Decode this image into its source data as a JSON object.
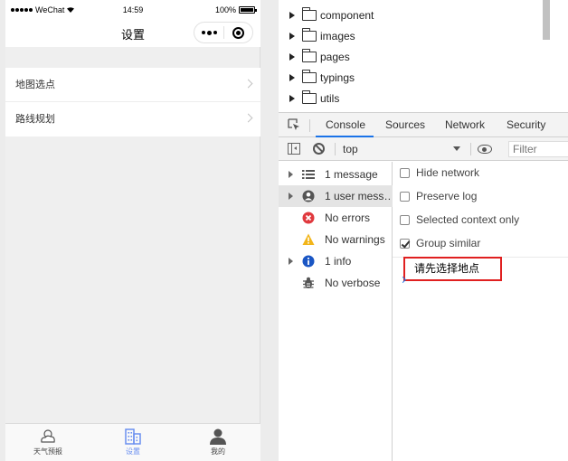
{
  "status_bar": {
    "carrier": "WeChat",
    "time": "14:59",
    "battery": "100%"
  },
  "navbar": {
    "title": "设置"
  },
  "menu_list": [
    {
      "label": "地图选点"
    },
    {
      "label": "路线规划"
    }
  ],
  "tabbar": [
    {
      "label": "天气预报",
      "icon": "weather-icon",
      "active": false
    },
    {
      "label": "设置",
      "icon": "city-icon",
      "active": true
    },
    {
      "label": "我的",
      "icon": "person-icon",
      "active": false
    }
  ],
  "file_tree": [
    {
      "name": "component"
    },
    {
      "name": "images"
    },
    {
      "name": "pages"
    },
    {
      "name": "typings"
    },
    {
      "name": "utils"
    }
  ],
  "devtools_tabs": [
    {
      "label": "Console",
      "active": true
    },
    {
      "label": "Sources",
      "active": false
    },
    {
      "label": "Network",
      "active": false
    },
    {
      "label": "Security",
      "active": false
    }
  ],
  "console_toolbar": {
    "context": "top",
    "filter_placeholder": "Filter"
  },
  "console_sidebar": [
    {
      "label": "1 message",
      "icon": "list-icon",
      "expandable": true,
      "selected": false
    },
    {
      "label": "1 user mess…",
      "icon": "user-icon",
      "expandable": true,
      "selected": true
    },
    {
      "label": "No errors",
      "icon": "error-icon",
      "expandable": false,
      "selected": false
    },
    {
      "label": "No warnings",
      "icon": "warning-icon",
      "expandable": false,
      "selected": false
    },
    {
      "label": "1 info",
      "icon": "info-icon",
      "expandable": true,
      "selected": false
    },
    {
      "label": "No verbose",
      "icon": "bug-icon",
      "expandable": false,
      "selected": false
    }
  ],
  "console_settings": [
    {
      "label": "Hide network",
      "checked": false
    },
    {
      "label": "Preserve log",
      "checked": false
    },
    {
      "label": "Selected context only",
      "checked": false
    },
    {
      "label": "Group similar",
      "checked": true
    }
  ],
  "console_output": {
    "message": "请先选择地点"
  },
  "colors": {
    "accent": "#1a73e8",
    "highlight": "#e02020",
    "tab_active": "#6a8ff0"
  }
}
